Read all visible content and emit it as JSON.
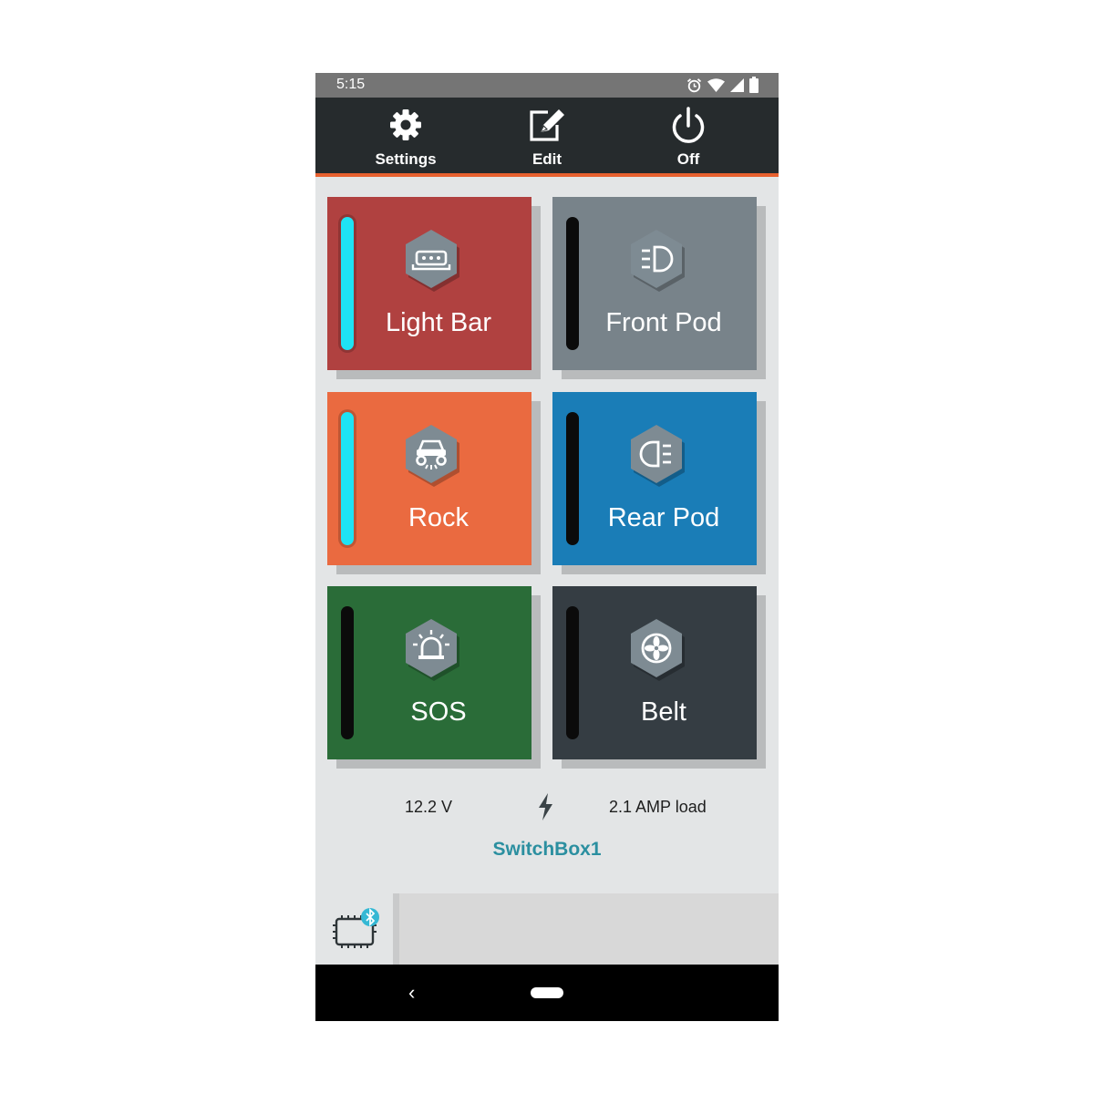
{
  "status_bar": {
    "time": "5:15",
    "icons": [
      "alarm-icon",
      "wifi-icon",
      "signal-icon",
      "battery-icon"
    ]
  },
  "toolbar": {
    "settings_label": "Settings",
    "edit_label": "Edit",
    "off_label": "Off",
    "accent_color": "#e8612f"
  },
  "switches": [
    {
      "label": "Light Bar",
      "on": true,
      "icon": "light-bar-icon",
      "color": "#b04140"
    },
    {
      "label": "Front Pod",
      "on": false,
      "icon": "front-light-icon",
      "color": "#78838a"
    },
    {
      "label": "Rock",
      "on": true,
      "icon": "rock-light-icon",
      "color": "#ea6a40"
    },
    {
      "label": "Rear Pod",
      "on": false,
      "icon": "rear-light-icon",
      "color": "#1a7db7"
    },
    {
      "label": "SOS",
      "on": false,
      "icon": "beacon-icon",
      "color": "#2a6c38"
    },
    {
      "label": "Belt",
      "on": false,
      "icon": "fan-icon",
      "color": "#353d43"
    }
  ],
  "readout": {
    "voltage": "12.2 V",
    "load": "2.1 AMP load",
    "icon": "bolt-icon"
  },
  "device": {
    "name": "SwitchBox1",
    "icon": "switchbox-bluetooth-icon"
  },
  "nav": {
    "back_glyph": "‹"
  }
}
